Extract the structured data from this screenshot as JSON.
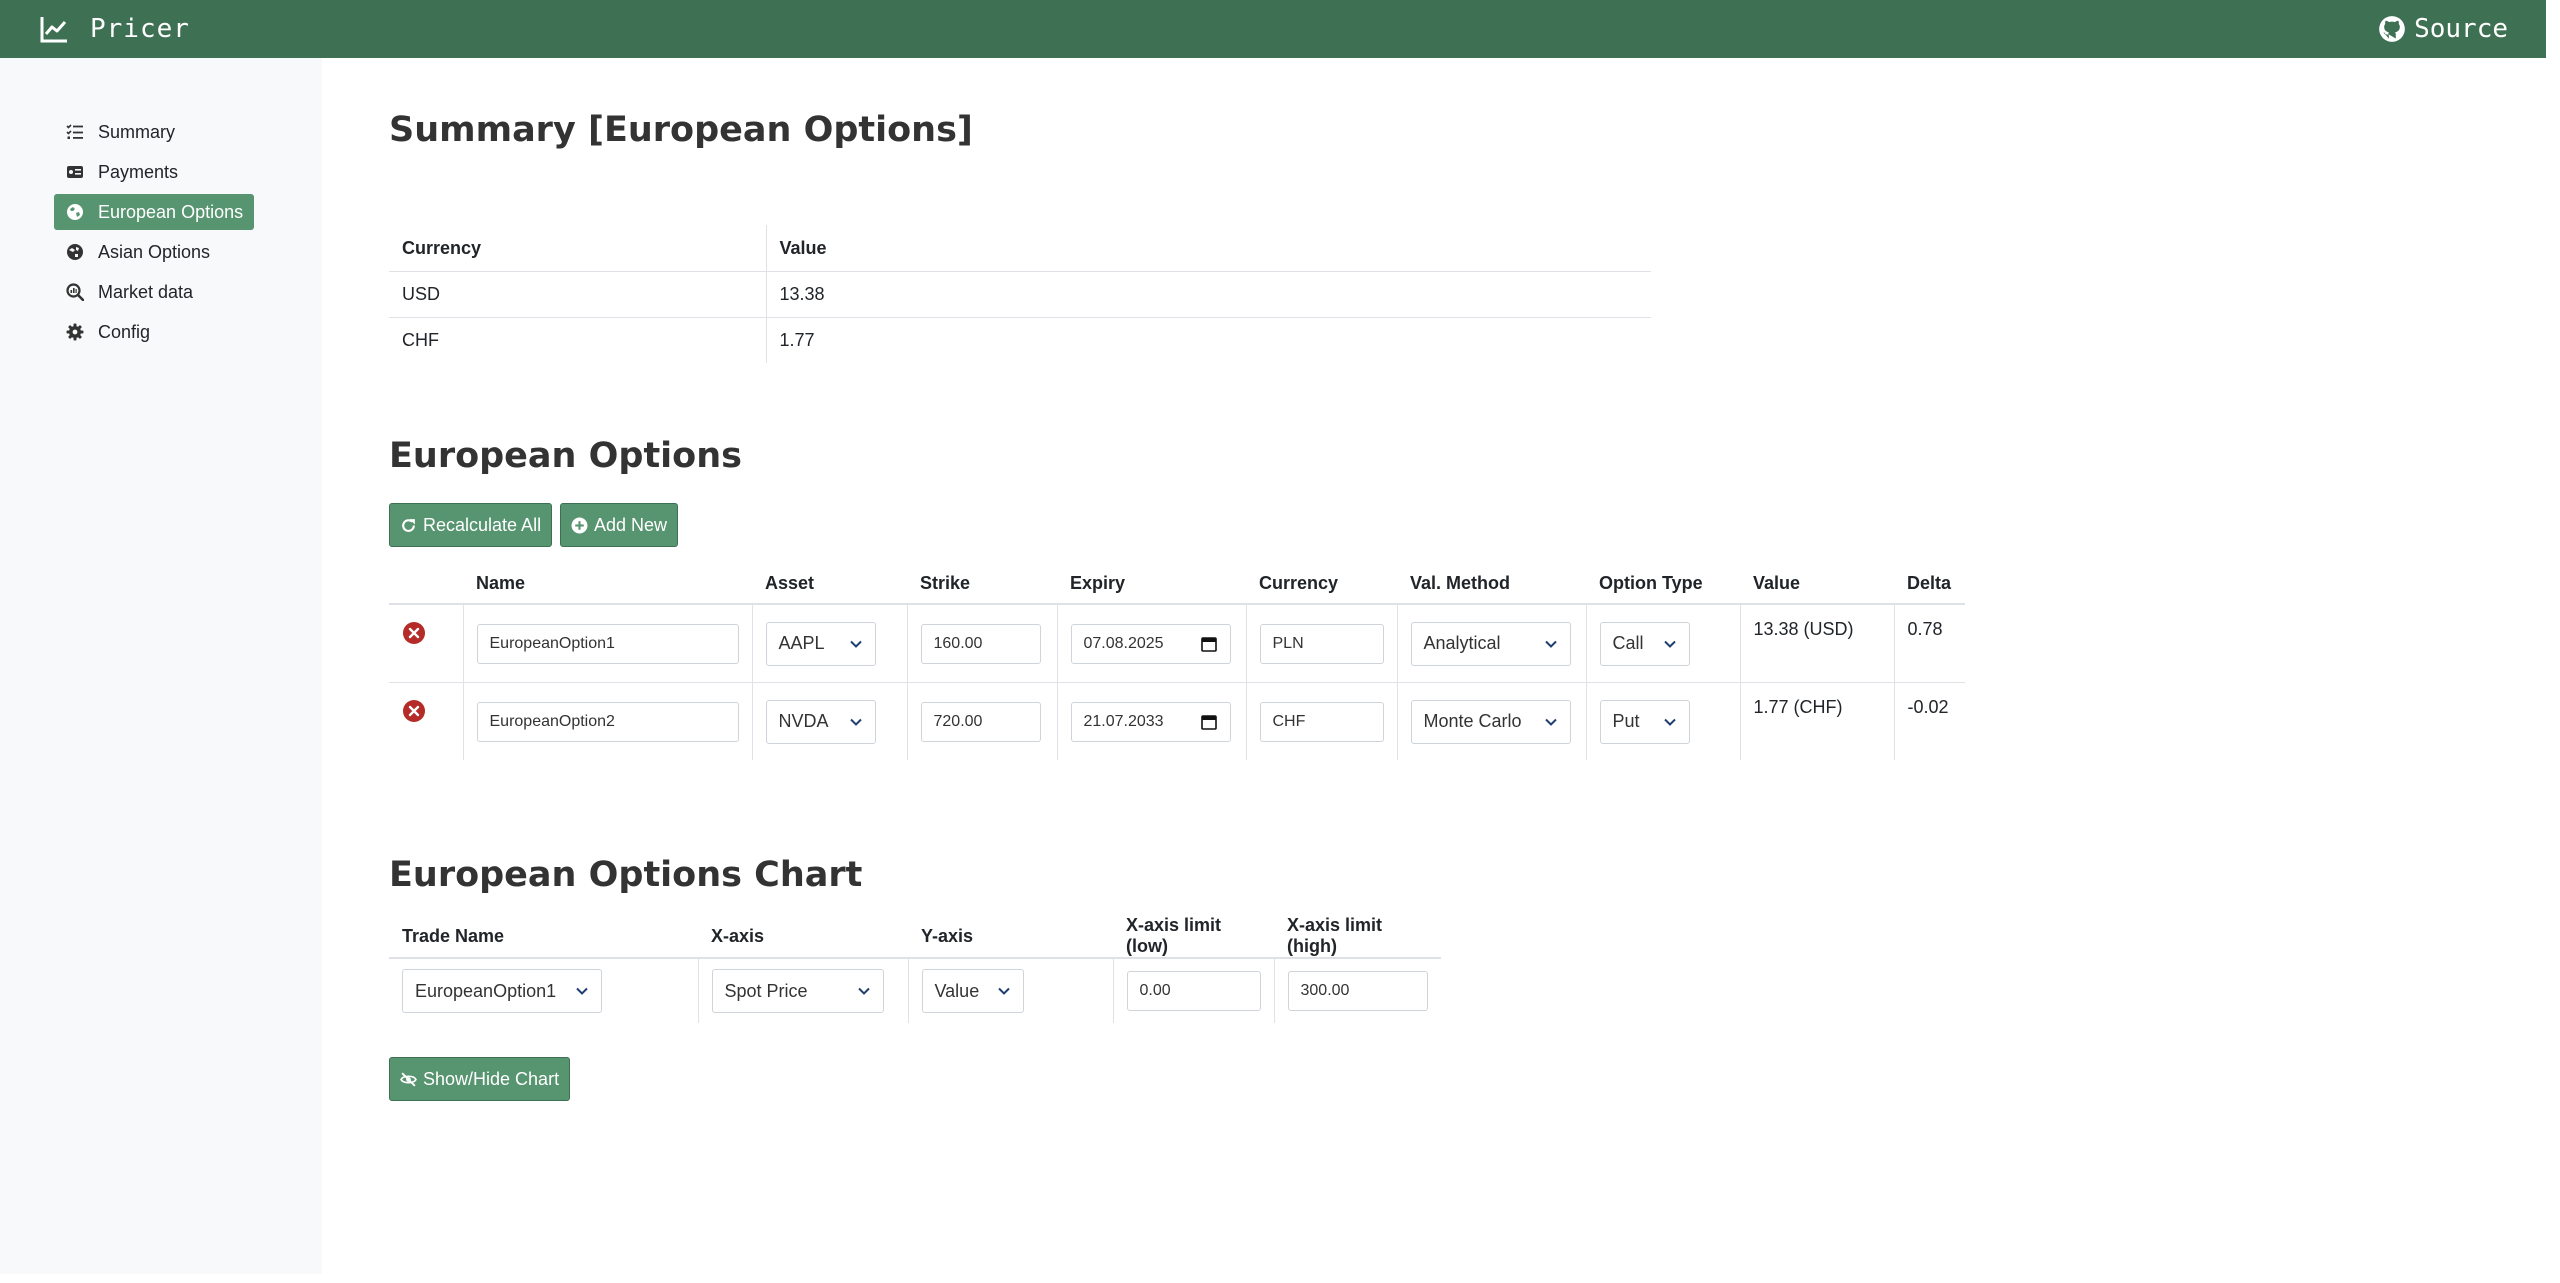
{
  "app": {
    "brand": "Pricer",
    "source_label": "Source",
    "colors": {
      "topbar": "#3e7153",
      "accent": "#579470",
      "delete": "#c0392b"
    }
  },
  "sidebar": {
    "items": [
      {
        "label": "Summary",
        "icon": "list-check-icon",
        "active": false
      },
      {
        "label": "Payments",
        "icon": "money-card-icon",
        "active": false
      },
      {
        "label": "European Options",
        "icon": "globe-europe-icon",
        "active": true
      },
      {
        "label": "Asian Options",
        "icon": "globe-asia-icon",
        "active": false
      },
      {
        "label": "Market data",
        "icon": "magnifier-chart-icon",
        "active": false
      },
      {
        "label": "Config",
        "icon": "gear-icon",
        "active": false
      }
    ]
  },
  "summary": {
    "title": "Summary [European Options]",
    "headers": [
      "Currency",
      "Value"
    ],
    "rows": [
      [
        "USD",
        "13.38"
      ],
      [
        "CHF",
        "1.77"
      ]
    ]
  },
  "options": {
    "title": "European Options",
    "recalc_label": "Recalculate All",
    "add_label": "Add New",
    "headers": [
      "",
      "Name",
      "Asset",
      "Strike",
      "Expiry",
      "Currency",
      "Val. Method",
      "Option Type",
      "Value",
      "Delta"
    ],
    "rows": [
      {
        "name": "EuropeanOption1",
        "asset": "AAPL",
        "strike": "160.00",
        "expiry": "07.08.2025",
        "currency": "PLN",
        "method": "Analytical",
        "type": "Call",
        "value": "13.38 (USD)",
        "delta": "0.78"
      },
      {
        "name": "EuropeanOption2",
        "asset": "NVDA",
        "strike": "720.00",
        "expiry": "21.07.2033",
        "currency": "CHF",
        "method": "Monte Carlo",
        "type": "Put",
        "value": "1.77 (CHF)",
        "delta": "-0.02"
      }
    ]
  },
  "chart": {
    "title": "European Options Chart",
    "headers": [
      "Trade Name",
      "X-axis",
      "Y-axis",
      "X-axis limit (low)",
      "X-axis limit (high)"
    ],
    "trade_name": "EuropeanOption1",
    "x_axis": "Spot Price",
    "y_axis": "Value",
    "x_low": "0.00",
    "x_high": "300.00",
    "toggle_label": "Show/Hide Chart"
  }
}
